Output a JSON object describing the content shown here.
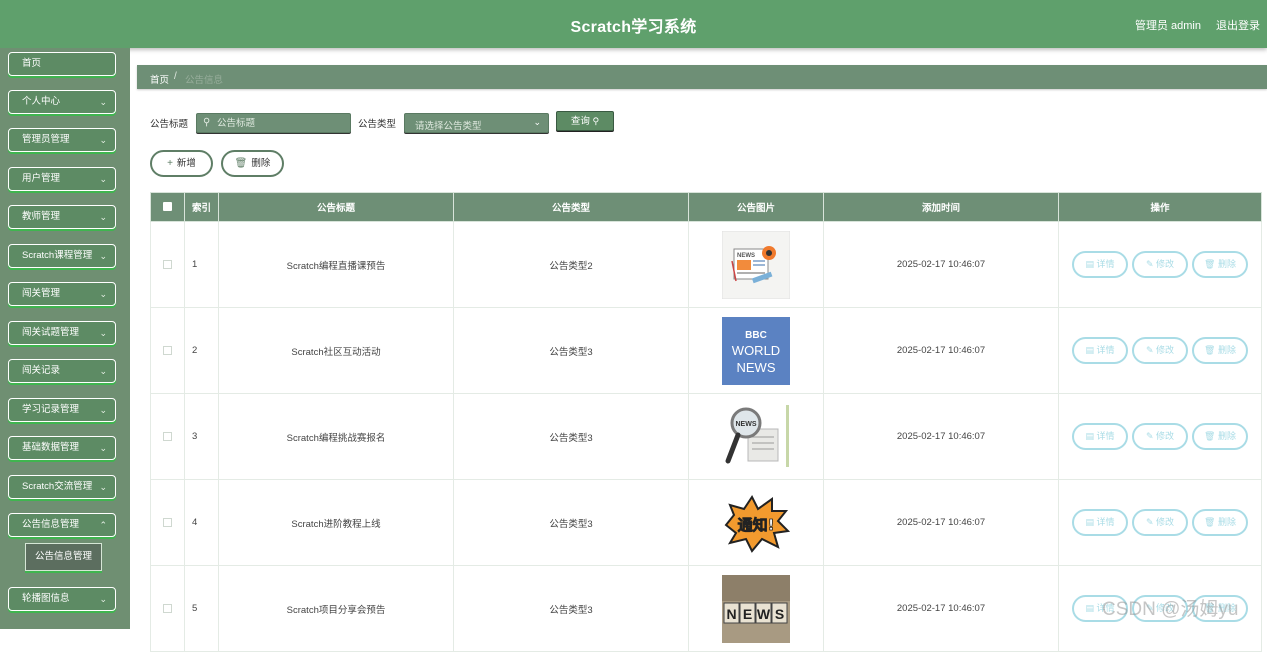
{
  "header": {
    "title": "Scratch学习系统",
    "user": "管理员 admin",
    "logout": "退出登录"
  },
  "sidebar": {
    "items": [
      {
        "label": "首页",
        "chevron": false
      },
      {
        "label": "个人中心",
        "chevron": true
      },
      {
        "label": "管理员管理",
        "chevron": true
      },
      {
        "label": "用户管理",
        "chevron": true
      },
      {
        "label": "教师管理",
        "chevron": true
      },
      {
        "label": "Scratch课程管理",
        "chevron": true
      },
      {
        "label": "闯关管理",
        "chevron": true
      },
      {
        "label": "闯关试题管理",
        "chevron": true
      },
      {
        "label": "闯关记录",
        "chevron": true
      },
      {
        "label": "学习记录管理",
        "chevron": true
      },
      {
        "label": "基础数据管理",
        "chevron": true
      },
      {
        "label": "Scratch交流管理",
        "chevron": true
      },
      {
        "label": "公告信息管理",
        "chevron": true
      },
      {
        "label": "轮播图信息",
        "chevron": true
      }
    ],
    "sub_item": "公告信息管理"
  },
  "breadcrumb": {
    "home": "首页",
    "separator": "/",
    "current": "公告信息"
  },
  "search": {
    "title_label": "公告标题",
    "title_placeholder": "公告标题",
    "type_label": "公告类型",
    "type_placeholder": "请选择公告类型",
    "query_label": "查询"
  },
  "toolbar": {
    "add_label": "新增",
    "delete_label": "删除"
  },
  "table": {
    "columns": [
      "索引",
      "公告标题",
      "公告类型",
      "公告图片",
      "添加时间",
      "操作"
    ],
    "rows": [
      {
        "index": "1",
        "title": "Scratch编程直播课预告",
        "type": "公告类型2",
        "image": "news-paper-icon",
        "time": "2025-02-17 10:46:07"
      },
      {
        "index": "2",
        "title": "Scratch社区互动活动",
        "type": "公告类型3",
        "image": "bbc-world-news",
        "time": "2025-02-17 10:46:07"
      },
      {
        "index": "3",
        "title": "Scratch编程挑战赛报名",
        "type": "公告类型3",
        "image": "magnifier-news",
        "time": "2025-02-17 10:46:07"
      },
      {
        "index": "4",
        "title": "Scratch进阶教程上线",
        "type": "公告类型3",
        "image": "notice-burst",
        "time": "2025-02-17 10:46:07"
      },
      {
        "index": "5",
        "title": "Scratch项目分享会预告",
        "type": "公告类型3",
        "image": "news-blocks",
        "time": "2025-02-17 10:46:07"
      }
    ],
    "actions": {
      "detail": "详情",
      "edit": "修改",
      "delete": "删除"
    }
  },
  "images": {
    "bbc": [
      "BBC",
      "WORLD",
      "NEWS"
    ],
    "notice": "通知!",
    "news_letters": [
      "N",
      "E",
      "W",
      "S"
    ],
    "paper": "NEWS"
  },
  "watermark": "CSDN @汤姆yu",
  "colors": {
    "header": "#5fa06c",
    "sidebar": "#6f8f72",
    "table_header": "#6e8f76",
    "action_outline": "#a9dce6"
  }
}
